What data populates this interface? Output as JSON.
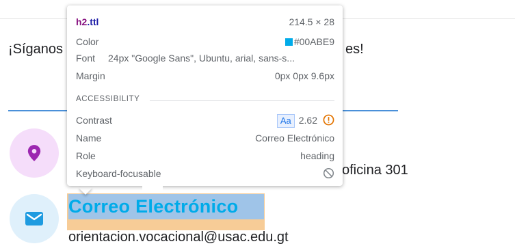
{
  "page": {
    "follow_text": "¡Síganos",
    "follow_tail": "es!",
    "address_tail": "oficina 301",
    "heading": "Correo Electrónico",
    "email": "orientacion.vocacional@usac.edu.gt"
  },
  "icons": {
    "location": "location-pin-icon",
    "mail": "mail-icon"
  },
  "colors": {
    "heading": "#00ABE9",
    "location_circle": "#F5DDFA",
    "mail_circle": "#DFF0FB",
    "location_icon": "#9C27B0",
    "mail_icon": "#1E9BE0"
  },
  "tooltip": {
    "selector_tag": "h2",
    "selector_class": ".ttl",
    "size": "214.5 × 28",
    "color_label": "Color",
    "color_value": "#00ABE9",
    "font_label": "Font",
    "font_value": "24px \"Google Sans\", Ubuntu, arial, sans-s...",
    "margin_label": "Margin",
    "margin_value": "0px 0px 9.6px",
    "accessibility_title": "ACCESSIBILITY",
    "contrast_label": "Contrast",
    "contrast_badge": "Aa",
    "contrast_value": "2.62",
    "name_label": "Name",
    "name_value": "Correo Electrónico",
    "role_label": "Role",
    "role_value": "heading",
    "keyboard_label": "Keyboard-focusable"
  }
}
